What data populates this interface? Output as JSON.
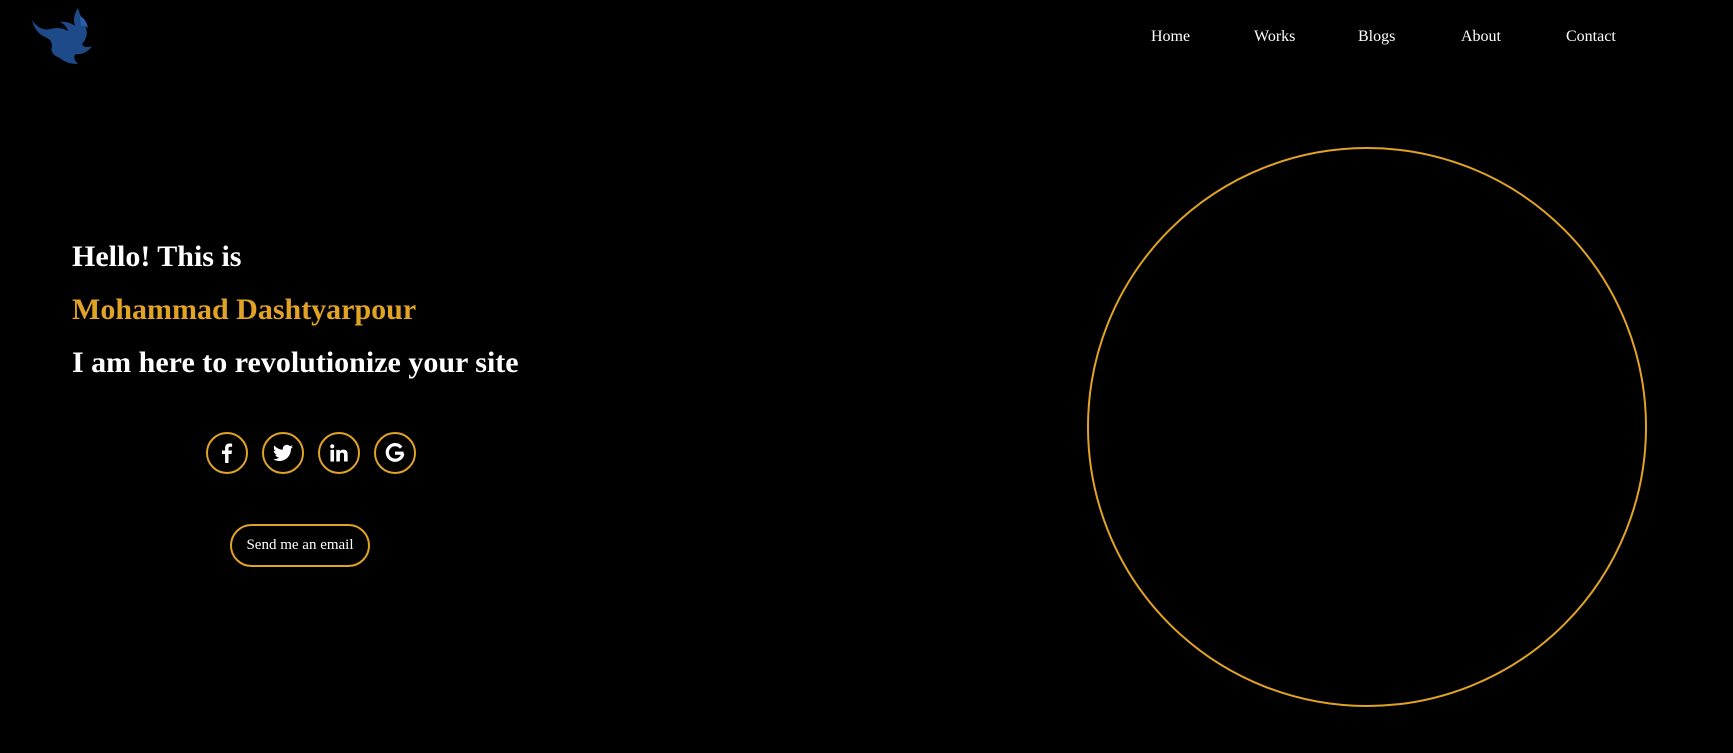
{
  "logo": {
    "icon": "eagle-logo-icon",
    "color": "#1e4a8a"
  },
  "nav": {
    "items": [
      {
        "label": "Home"
      },
      {
        "label": "Works"
      },
      {
        "label": "Blogs"
      },
      {
        "label": "About"
      },
      {
        "label": "Contact"
      }
    ]
  },
  "hero": {
    "greeting": "Hello! This is",
    "name": "Mohammad Dashtyarpour",
    "tagline": "I am here to revolutionize your site"
  },
  "socials": [
    {
      "icon": "facebook-icon"
    },
    {
      "icon": "twitter-icon"
    },
    {
      "icon": "linkedin-icon"
    },
    {
      "icon": "google-icon"
    }
  ],
  "cta": {
    "label": "Send me an email"
  },
  "colors": {
    "background": "#000000",
    "accent": "#e1a324",
    "text": "#ffffff",
    "logo": "#1e4a8a"
  }
}
